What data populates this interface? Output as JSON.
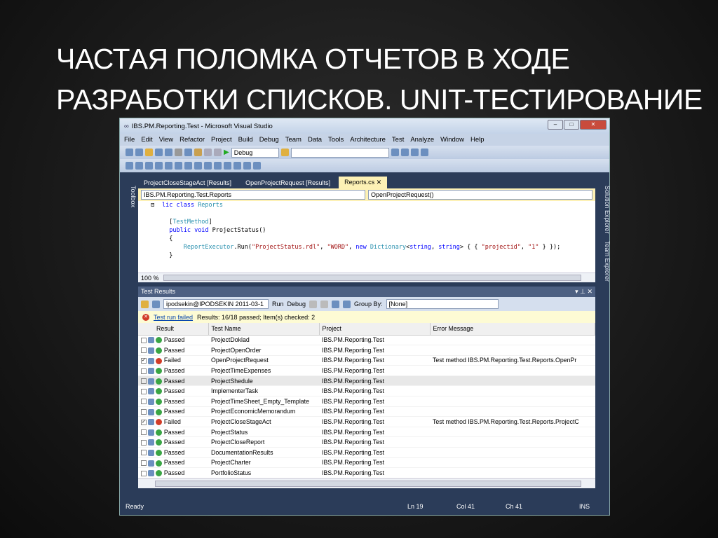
{
  "slide_title": "Частая поломка отчетов в ходе разработки списков. Unit-тестирование",
  "window": {
    "title": "IBS.PM.Reporting.Test - Microsoft Visual Studio"
  },
  "menu": [
    "File",
    "Edit",
    "View",
    "Refactor",
    "Project",
    "Build",
    "Debug",
    "Team",
    "Data",
    "Tools",
    "Architecture",
    "Test",
    "Analyze",
    "Window",
    "Help"
  ],
  "toolbar": {
    "config": "Debug"
  },
  "side": {
    "left": "Toolbox",
    "right1": "Solution Explorer",
    "right2": "Team Explorer"
  },
  "tabs": [
    {
      "label": "ProjectCloseStageAct [Results]"
    },
    {
      "label": "OpenProjectRequest [Results]"
    },
    {
      "label": "Reports.cs ✕"
    }
  ],
  "nav": {
    "type": "IBS.PM.Reporting.Test.Reports",
    "member": "OpenProjectRequest()"
  },
  "zoom": "100 %",
  "test_results": {
    "title": "Test Results",
    "run": "ipodsekin@IPODSEKIN 2011-03-1",
    "run_btn": "Run",
    "debug_btn": "Debug",
    "group_by_label": "Group By:",
    "group_by": "[None]",
    "failed_link": "Test run failed",
    "summary": "Results: 16/18 passed;  Item(s) checked: 2",
    "columns": [
      "Result",
      "Test Name",
      "Project",
      "Error Message"
    ],
    "rows": [
      [
        "Passed",
        "ProjectDoklad",
        "IBS.PM.Reporting.Test",
        ""
      ],
      [
        "Passed",
        "ProjectOpenOrder",
        "IBS.PM.Reporting.Test",
        ""
      ],
      [
        "Failed",
        "OpenProjectRequest",
        "IBS.PM.Reporting.Test",
        "Test method IBS.PM.Reporting.Test.Reports.OpenPr"
      ],
      [
        "Passed",
        "ProjectTimeExpenses",
        "IBS.PM.Reporting.Test",
        ""
      ],
      [
        "Passed",
        "ProjectShedule",
        "IBS.PM.Reporting.Test",
        ""
      ],
      [
        "Passed",
        "ImplementerTask",
        "IBS.PM.Reporting.Test",
        ""
      ],
      [
        "Passed",
        "ProjectTimeSheet_Empty_Template",
        "IBS.PM.Reporting.Test",
        ""
      ],
      [
        "Passed",
        "ProjectEconomicMemorandum",
        "IBS.PM.Reporting.Test",
        ""
      ],
      [
        "Failed",
        "ProjectCloseStageAct",
        "IBS.PM.Reporting.Test",
        "Test method IBS.PM.Reporting.Test.Reports.ProjectC"
      ],
      [
        "Passed",
        "ProjectStatus",
        "IBS.PM.Reporting.Test",
        ""
      ],
      [
        "Passed",
        "ProjectCloseReport",
        "IBS.PM.Reporting.Test",
        ""
      ],
      [
        "Passed",
        "DocumentationResults",
        "IBS.PM.Reporting.Test",
        ""
      ],
      [
        "Passed",
        "ProjectCharter",
        "IBS.PM.Reporting.Test",
        ""
      ],
      [
        "Passed",
        "PortfolioStatus",
        "IBS.PM.Reporting.Test",
        ""
      ]
    ]
  },
  "statusbar": {
    "state": "Ready",
    "ln": "Ln 19",
    "col": "Col 41",
    "ch": "Ch 41",
    "mode": "INS"
  }
}
